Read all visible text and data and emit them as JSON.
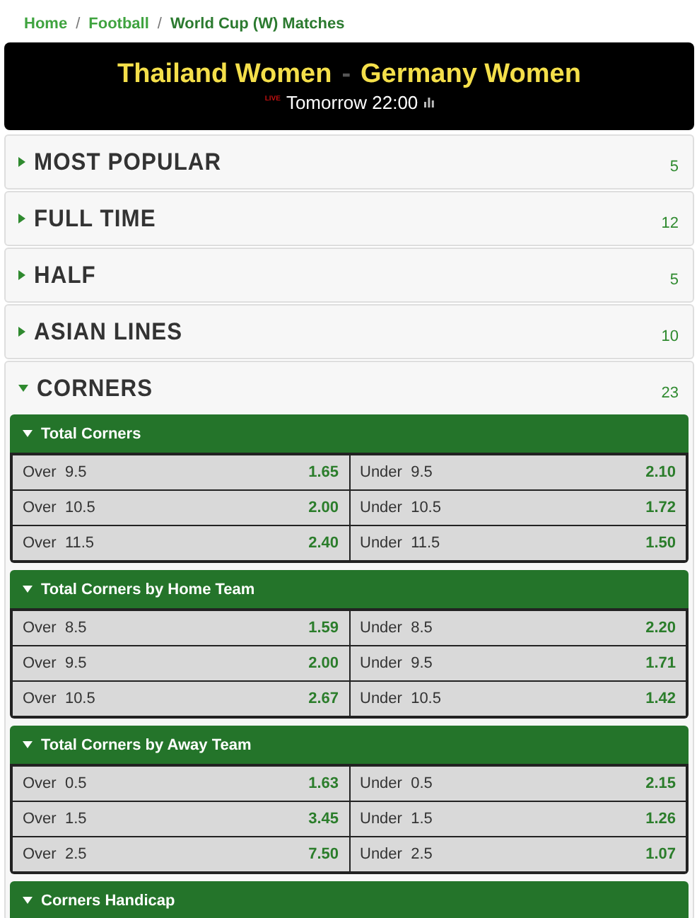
{
  "breadcrumb": [
    {
      "label": "Home",
      "current": false
    },
    {
      "separator": "/",
      "label": "Football",
      "current": false
    },
    {
      "separator": "/",
      "label": "World Cup (W) Matches",
      "current": true
    }
  ],
  "match": {
    "home": "Thailand Women",
    "separator": "-",
    "away": "Germany Women",
    "live_badge": "LIVE",
    "time": "Tomorrow 22:00"
  },
  "categories": [
    {
      "title": "MOST POPULAR",
      "count": "5",
      "expanded": false
    },
    {
      "title": "FULL TIME",
      "count": "12",
      "expanded": false
    },
    {
      "title": "HALF",
      "count": "5",
      "expanded": false
    },
    {
      "title": "ASIAN LINES",
      "count": "10",
      "expanded": false
    },
    {
      "title": "CORNERS",
      "count": "23",
      "expanded": true,
      "markets": [
        {
          "title": "Total Corners",
          "expanded": true,
          "rows": [
            [
              {
                "label": "Over  9.5",
                "odds": "1.65"
              },
              {
                "label": "Under  9.5",
                "odds": "2.10"
              }
            ],
            [
              {
                "label": "Over  10.5",
                "odds": "2.00"
              },
              {
                "label": "Under  10.5",
                "odds": "1.72"
              }
            ],
            [
              {
                "label": "Over  11.5",
                "odds": "2.40"
              },
              {
                "label": "Under  11.5",
                "odds": "1.50"
              }
            ]
          ]
        },
        {
          "title": "Total Corners by Home Team",
          "expanded": true,
          "rows": [
            [
              {
                "label": "Over  8.5",
                "odds": "1.59"
              },
              {
                "label": "Under  8.5",
                "odds": "2.20"
              }
            ],
            [
              {
                "label": "Over  9.5",
                "odds": "2.00"
              },
              {
                "label": "Under  9.5",
                "odds": "1.71"
              }
            ],
            [
              {
                "label": "Over  10.5",
                "odds": "2.67"
              },
              {
                "label": "Under  10.5",
                "odds": "1.42"
              }
            ]
          ]
        },
        {
          "title": "Total Corners by Away Team",
          "expanded": true,
          "rows": [
            [
              {
                "label": "Over  0.5",
                "odds": "1.63"
              },
              {
                "label": "Under  0.5",
                "odds": "2.15"
              }
            ],
            [
              {
                "label": "Over  1.5",
                "odds": "3.45"
              },
              {
                "label": "Under  1.5",
                "odds": "1.26"
              }
            ],
            [
              {
                "label": "Over  2.5",
                "odds": "7.50"
              },
              {
                "label": "Under  2.5",
                "odds": "1.07"
              }
            ]
          ]
        },
        {
          "title": "Corners Handicap",
          "expanded": true
        }
      ]
    }
  ]
}
